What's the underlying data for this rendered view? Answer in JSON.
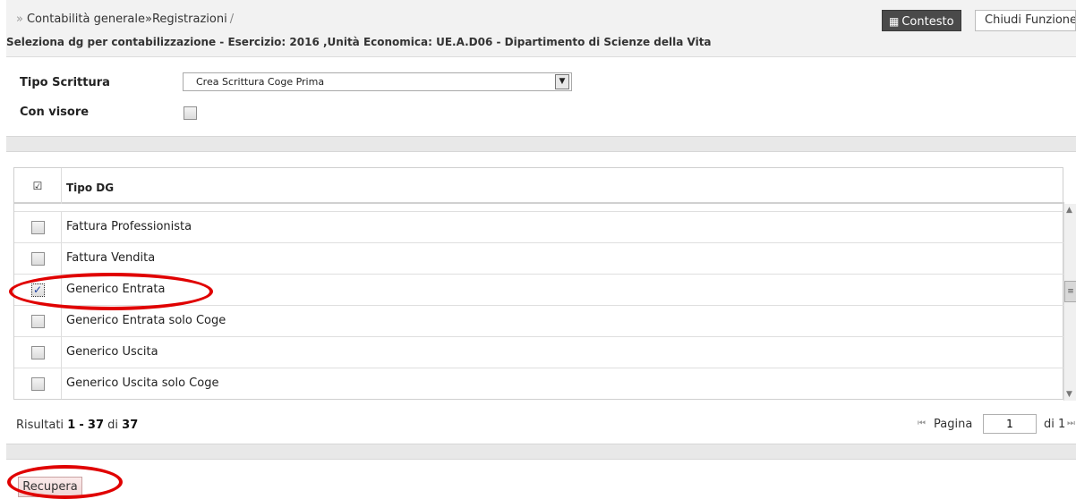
{
  "breadcrumb": {
    "prefix": "»",
    "text": "Contabilità generale»Registrazioni",
    "suffix": "/"
  },
  "context_title": "Seleziona dg per contabilizzazione - Esercizio: 2016 ,Unità Economica: UE.A.D06 - Dipartimento di Scienze della Vita",
  "toolbar": {
    "contesto_icon": "qr-code-icon",
    "contesto_label": "Contesto",
    "chiudi_label": "Chiudi Funzione"
  },
  "form": {
    "tipo_scrittura_label": "Tipo Scrittura",
    "tipo_scrittura_value": "Crea Scrittura Coge Prima",
    "con_visore_label": "Con visore",
    "con_visore_checked": false
  },
  "grid": {
    "header_check_icon": "check-all-icon",
    "header_label": "Tipo DG",
    "rows": [
      {
        "label": "Fattura Professionista",
        "checked": false
      },
      {
        "label": "Fattura Vendita",
        "checked": false
      },
      {
        "label": "Generico Entrata",
        "checked": true
      },
      {
        "label": "Generico Entrata solo Coge",
        "checked": false
      },
      {
        "label": "Generico Uscita",
        "checked": false
      },
      {
        "label": "Generico Uscita solo Coge",
        "checked": false
      }
    ]
  },
  "results": {
    "prefix": "Risultati",
    "from": "1",
    "dash": "-",
    "to": "37",
    "of_word": "di",
    "total": "37"
  },
  "pager": {
    "label": "Pagina",
    "page": "1",
    "of_label": "di 1"
  },
  "actions": {
    "recupera_label": "Recupera"
  },
  "annotations": {
    "highlight_color": "#e00000"
  }
}
